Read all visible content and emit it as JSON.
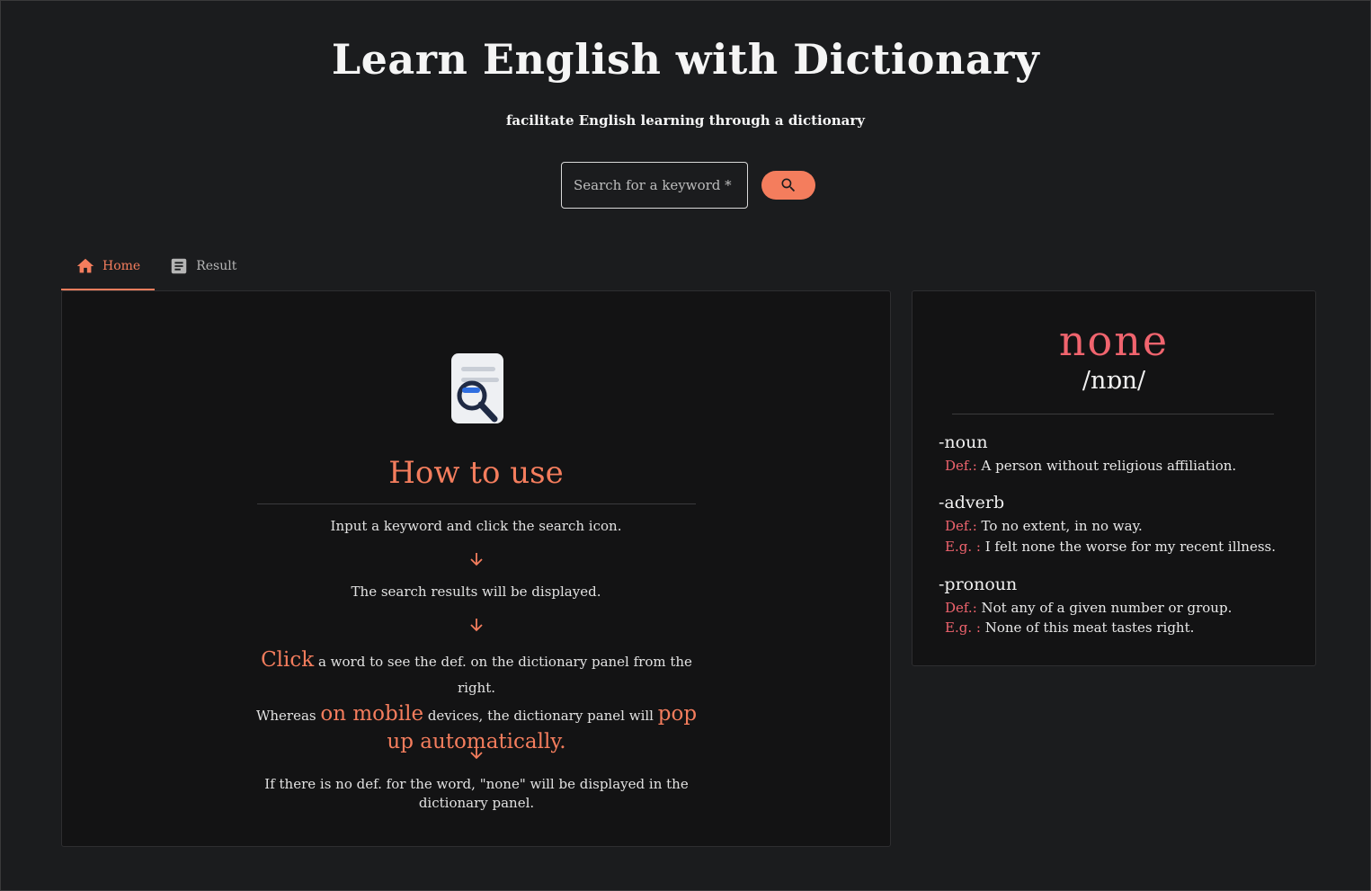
{
  "header": {
    "title": "Learn English with Dictionary",
    "subtitle": "facilitate English learning through a dictionary"
  },
  "search": {
    "placeholder": "Search for a keyword *",
    "button_icon": "search-icon"
  },
  "tabs": [
    {
      "label": "Home",
      "icon": "home-icon",
      "active": true
    },
    {
      "label": "Result",
      "icon": "article-icon",
      "active": false
    }
  ],
  "howto": {
    "icon": "document-search-icon",
    "title": "How to use",
    "step1": "Input a keyword and click the search icon.",
    "step2": "The search results will be displayed.",
    "step3": {
      "click": "Click",
      "part1": " a word to see the def. on the dictionary panel from the right.",
      "part2": "Whereas ",
      "on_mobile": "on mobile",
      "part3": " devices, the dictionary panel will ",
      "pop_up": "pop up automatically."
    },
    "step4": "If there is no def. for the word, \"none\" will be displayed in the dictionary panel."
  },
  "dictionary": {
    "word": "none",
    "phonetic": "/nɒn/",
    "entries": [
      {
        "pos": "-noun",
        "def_label": "Def.:",
        "def": "A person without religious affiliation."
      },
      {
        "pos": "-adverb",
        "def_label": "Def.:",
        "def": "To no extent, in no way.",
        "eg_label": "E.g. :",
        "eg": "I felt none the worse for my recent illness."
      },
      {
        "pos": "-pronoun",
        "def_label": "Def.:",
        "def": "Not any of a given number or group.",
        "eg_label": "E.g. :",
        "eg": "None of this meat tastes right."
      }
    ]
  },
  "colors": {
    "accent": "#f47d5d",
    "dictionary_accent": "#f0646e",
    "background": "#1b1c1e",
    "panel": "#131314"
  }
}
